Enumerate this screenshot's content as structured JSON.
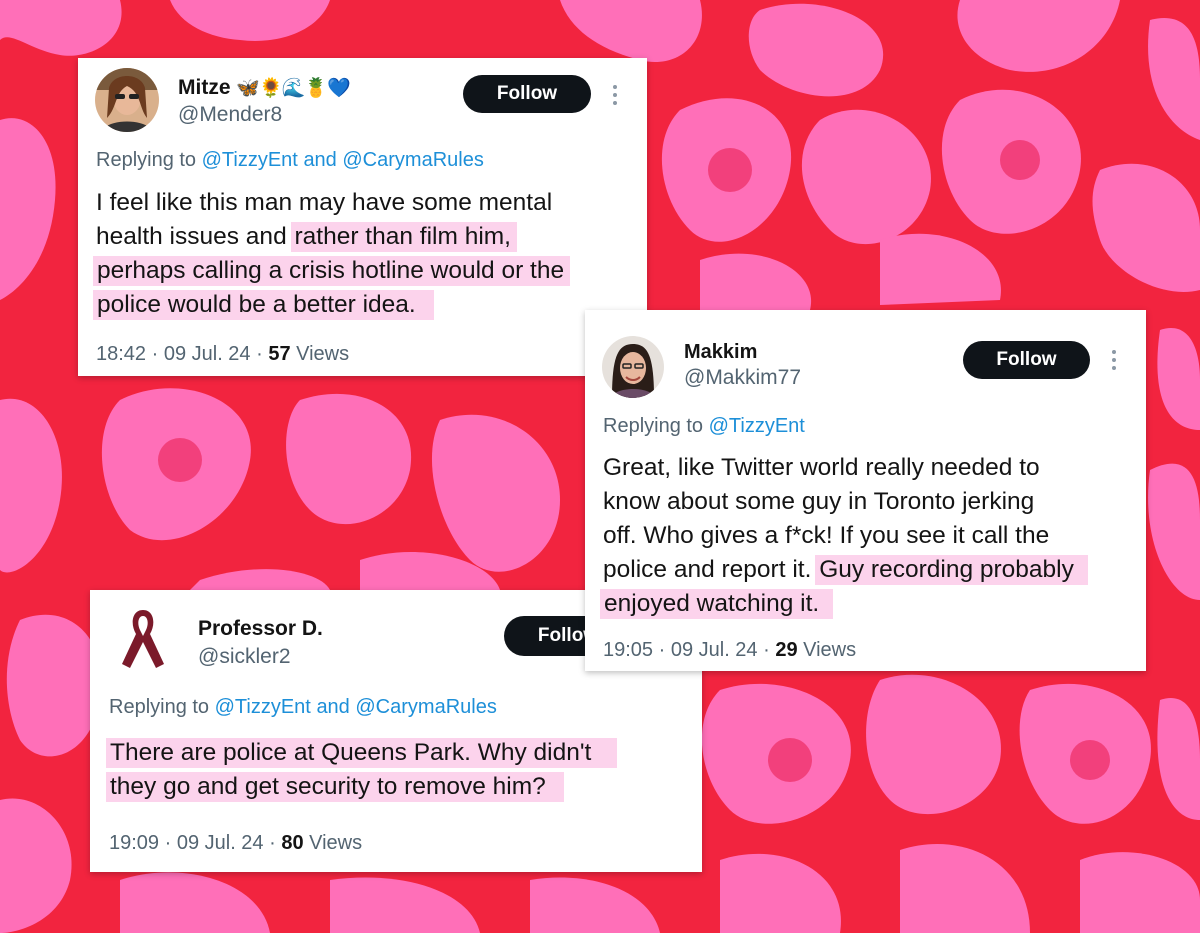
{
  "colors": {
    "background": "#f2243f",
    "spots": "#ff6fb8",
    "highlight": "#fcd3ec",
    "link": "#1d8fd8"
  },
  "tweets": [
    {
      "name": "Mitze",
      "name_emoji": "🦋🌻🌊🍍💙",
      "handle": "@Mender8",
      "follow_label": "Follow",
      "replying_to": "Replying to",
      "reply_user_1": "@TizzyEnt",
      "reply_and": "and",
      "reply_user_2": "@CarymaRules",
      "lines": [
        "I feel like this man may have some mental",
        "health issues and ",
        "rather than film him,",
        "perhaps calling a crisis hotline would or the",
        "police would be a better idea."
      ],
      "time": "18:42 · 09 Jul. 24 · ",
      "views_count": "57",
      "views_label": " Views"
    },
    {
      "name": "Makkim",
      "handle": "@Makkim77",
      "follow_label": "Follow",
      "replying_to": "Replying to",
      "reply_user_1": "@TizzyEnt",
      "lines": [
        "Great, like Twitter world really needed to",
        "know about some guy in Toronto jerking",
        "off. Who gives a f*ck! If you see it call the",
        "police and report it. ",
        "Guy recording probably",
        "enjoyed watching it."
      ],
      "time": "19:05 · 09 Jul. 24 · ",
      "views_count": "29",
      "views_label": " Views"
    },
    {
      "name": "Professor D.",
      "handle": "@sickler2",
      "follow_label": "Follow",
      "replying_to": "Replying to",
      "reply_user_1": "@TizzyEnt",
      "reply_and": "and",
      "reply_user_2": "@CarymaRules",
      "lines": [
        "There are police at Queens Park.  Why didn't",
        "they go and get security to remove him?"
      ],
      "time": "19:09 · 09 Jul. 24 · ",
      "views_count": "80",
      "views_label": " Views"
    }
  ],
  "icons": {
    "more": "more-vertical-icon",
    "ribbon": "awareness-ribbon-icon"
  }
}
